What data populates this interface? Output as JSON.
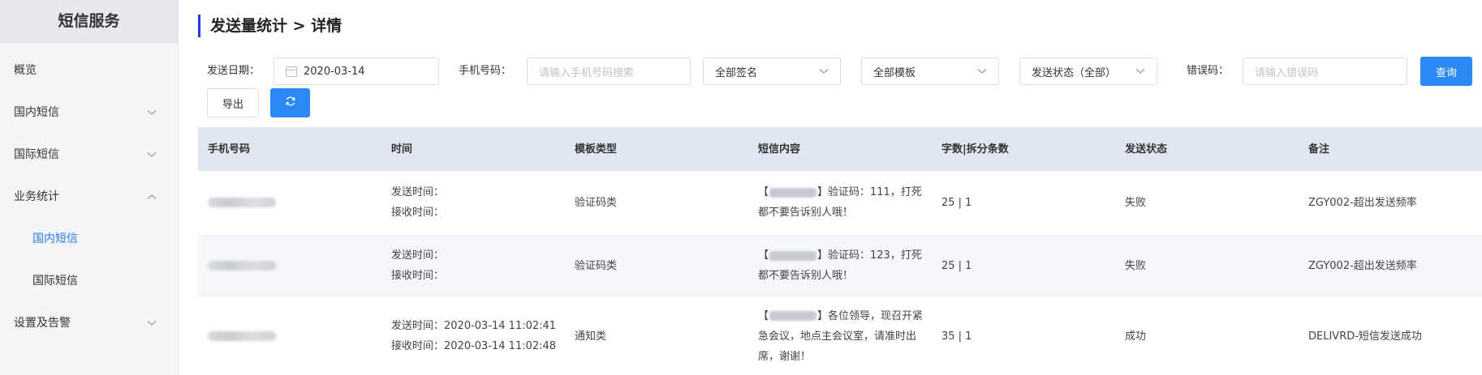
{
  "sidebar": {
    "title": "短信服务",
    "items": [
      {
        "label": "概览"
      },
      {
        "label": "国内短信"
      },
      {
        "label": "国际短信"
      },
      {
        "label": "业务统计"
      },
      {
        "label": "国内短信"
      },
      {
        "label": "国际短信"
      },
      {
        "label": "设置及告警"
      }
    ]
  },
  "page": {
    "title": "发送量统计 > 详情"
  },
  "filters": {
    "date_label": "发送日期：",
    "date_value": "2020-03-14",
    "phone_label": "手机号码：",
    "phone_placeholder": "请输入手机号码搜索",
    "sign_value": "全部签名",
    "template_value": "全部模板",
    "status_value": "发送状态（全部）",
    "error_label": "错误码：",
    "error_placeholder": "请输入错误码",
    "query_label": "查询",
    "export_label": "导出"
  },
  "table": {
    "headers": [
      "手机号码",
      "时间",
      "模板类型",
      "短信内容",
      "字数|拆分条数",
      "发送状态",
      "备注"
    ],
    "rows": [
      {
        "send_time": "发送时间：",
        "recv_time": "接收时间：",
        "type": "验证码类",
        "content_open": "【",
        "content_line1": "】验证码：111，打死",
        "content_line2": "都不要告诉别人哦！",
        "content_line3": "",
        "count": "25 | 1",
        "status": "失败",
        "note": "ZGY002-超出发送频率"
      },
      {
        "send_time": "发送时间：",
        "recv_time": "接收时间：",
        "type": "验证码类",
        "content_open": "【",
        "content_line1": "】验证码：123，打死",
        "content_line2": "都不要告诉别人哦！",
        "content_line3": "",
        "count": "25 | 1",
        "status": "失败",
        "note": "ZGY002-超出发送频率"
      },
      {
        "send_time": "发送时间：2020-03-14 11:02:41",
        "recv_time": "接收时间：2020-03-14 11:02:48",
        "type": "通知类",
        "content_open": "【",
        "content_line1": "】各位领导，现召开紧",
        "content_line2": "急会议，地点主会议室，请准时出",
        "content_line3": "席，谢谢！",
        "count": "35 | 1",
        "status": "成功",
        "note": "DELIVRD-短信发送成功"
      }
    ]
  },
  "colors": {
    "accent": "#2b89f5",
    "title_bar": "#2b3bd8",
    "active_nav": "#2b7de9"
  }
}
